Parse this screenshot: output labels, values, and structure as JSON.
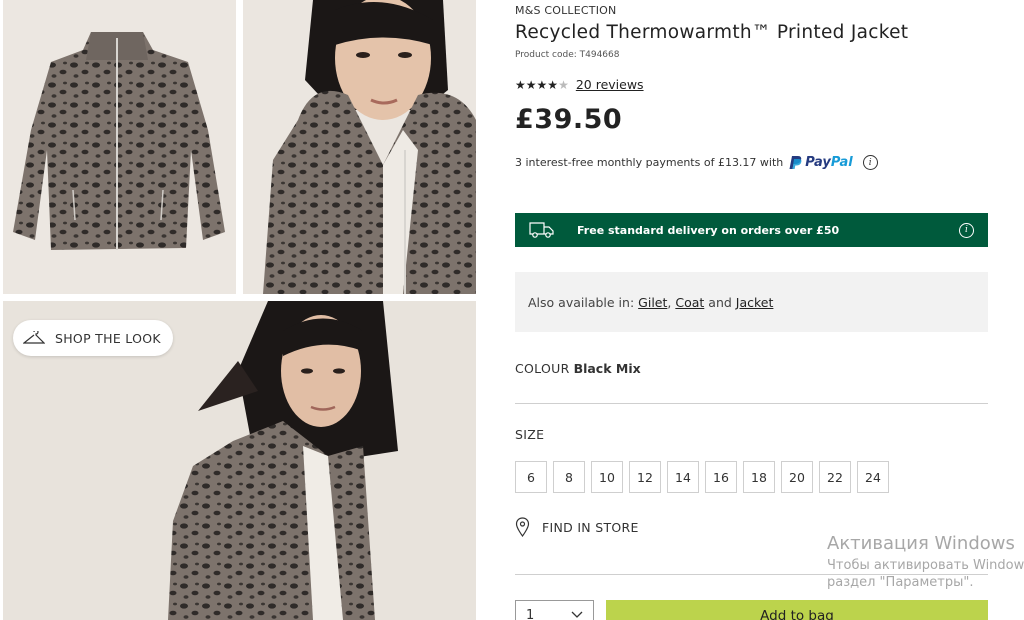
{
  "product": {
    "brand": "M&S COLLECTION",
    "title": "Recycled Thermowarmth™ Printed Jacket",
    "code": "Product code: T494668",
    "rating": 4,
    "rating_max": 5,
    "reviews": "20 reviews",
    "price": "£39.50"
  },
  "payment": {
    "text": "3 interest-free monthly payments of £13.17 with",
    "paypal_part1": "Pay",
    "paypal_part2": "Pal"
  },
  "delivery": {
    "text": "Free standard delivery on orders over £50"
  },
  "availability": {
    "prefix": "Also available in:",
    "links": [
      "Gilet",
      "Coat",
      "Jacket"
    ],
    "sep1": ",",
    "conj": "and"
  },
  "colour": {
    "label": "COLOUR",
    "value": "Black Mix"
  },
  "size": {
    "label": "SIZE",
    "options": [
      "6",
      "8",
      "10",
      "12",
      "14",
      "16",
      "18",
      "20",
      "22",
      "24"
    ]
  },
  "store": {
    "label": "FIND IN STORE"
  },
  "purchase": {
    "quantity": "1",
    "add_label": "Add to bag"
  },
  "gallery": {
    "shop_look": "SHOP THE LOOK"
  },
  "os_overlay": {
    "line1": "Активация Windows",
    "line2": "Чтобы активировать Windows, перейдите в",
    "line3": "раздел \"Параметры\"."
  },
  "colors": {
    "delivery_bg": "#005a3c",
    "add_bag_bg": "#bcd34c",
    "avail_bg": "#f2f2f2"
  }
}
